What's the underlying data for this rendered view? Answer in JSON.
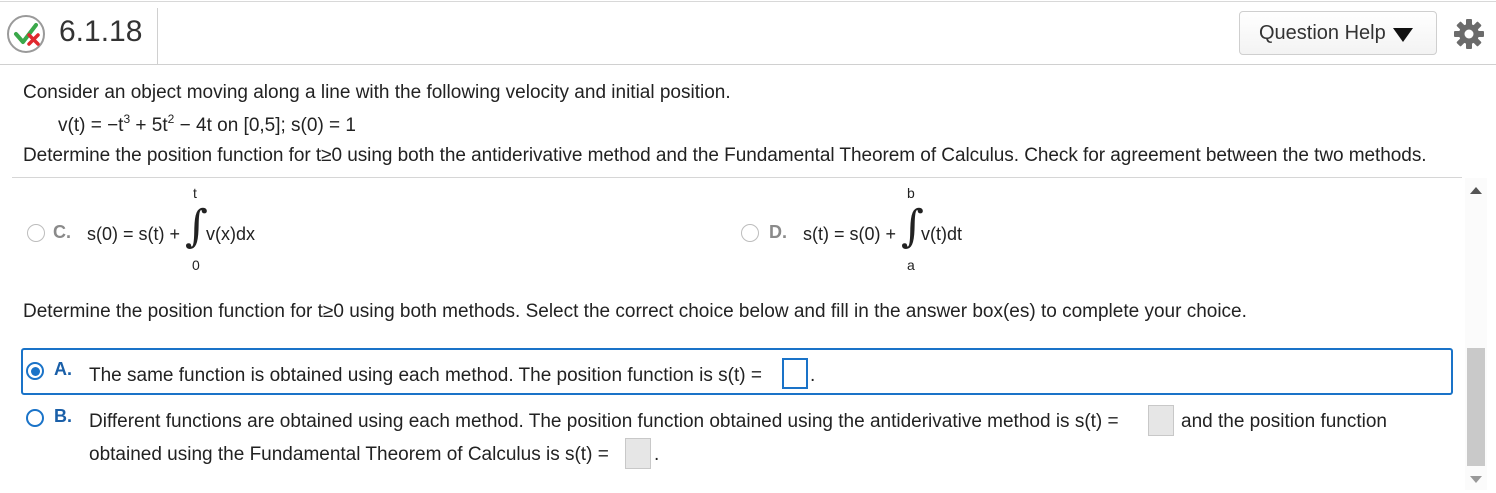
{
  "header": {
    "question_number": "6.1.18",
    "help_label": "Question Help",
    "status_icon": "partial-correct-icon",
    "settings_icon": "gear-icon"
  },
  "problem": {
    "intro": "Consider an object moving along a line with the following velocity and initial position.",
    "eq_vt": "v(t) = −t",
    "eq_exp1": "3",
    "eq_mid": " + 5t",
    "eq_exp2": "2",
    "eq_rest": " − 4t on [0,5]; s(0) = 1",
    "instruction": "Determine the position function for t≥0 using both the antiderivative method and the Fundamental Theorem of Calculus. Check for agreement between the two methods."
  },
  "options": {
    "c": {
      "letter": "C.",
      "lhs": "s(0) = s(t) +",
      "integrand": "v(x)dx",
      "upper": "t",
      "lower": "0"
    },
    "d": {
      "letter": "D.",
      "lhs": "s(t) = s(0) +",
      "integrand": "v(t)dt",
      "upper": "b",
      "lower": "a"
    }
  },
  "part2": {
    "instruction": "Determine the position function for t≥0 using both methods. Select the correct choice below and fill in the answer box(es) to complete your choice.",
    "choice_a": {
      "letter": "A.",
      "text": "The same function is obtained using each method. The position function is s(t) =",
      "answer": "",
      "selected": true
    },
    "choice_b": {
      "letter": "B.",
      "text_line1": "Different functions are obtained using each method. The position function obtained using the antiderivative method is s(t) =",
      "text_mid": "and the position function",
      "text_line2": "obtained using the Fundamental Theorem of Calculus is s(t) =",
      "answer1": "",
      "answer2": "",
      "selected": false
    }
  },
  "colors": {
    "accent": "#1a73c8",
    "correct_check": "#3aa84a",
    "incorrect_x": "#e0282e"
  }
}
